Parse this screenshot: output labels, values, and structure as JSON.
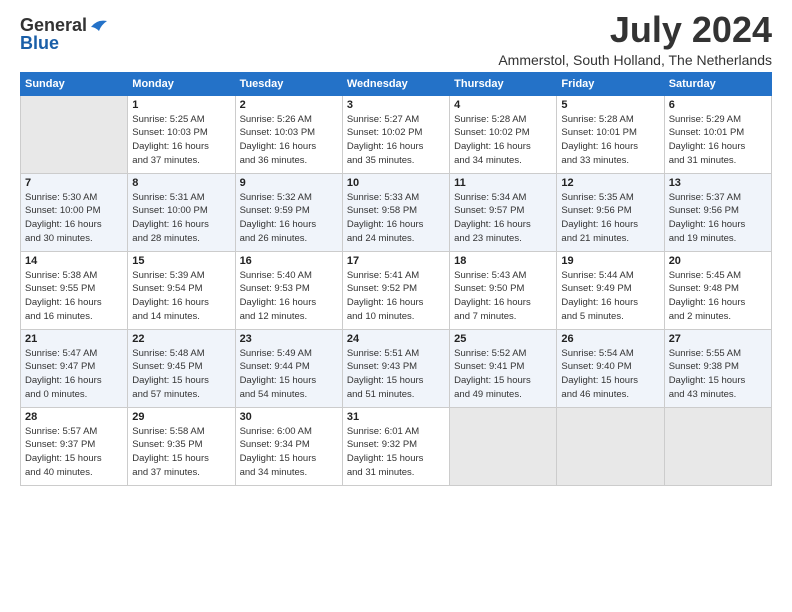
{
  "header": {
    "logo_general": "General",
    "logo_blue": "Blue",
    "month_title": "July 2024",
    "subtitle": "Ammerstol, South Holland, The Netherlands"
  },
  "columns": [
    "Sunday",
    "Monday",
    "Tuesday",
    "Wednesday",
    "Thursday",
    "Friday",
    "Saturday"
  ],
  "weeks": [
    [
      {
        "day": "",
        "info": ""
      },
      {
        "day": "1",
        "info": "Sunrise: 5:25 AM\nSunset: 10:03 PM\nDaylight: 16 hours\nand 37 minutes."
      },
      {
        "day": "2",
        "info": "Sunrise: 5:26 AM\nSunset: 10:03 PM\nDaylight: 16 hours\nand 36 minutes."
      },
      {
        "day": "3",
        "info": "Sunrise: 5:27 AM\nSunset: 10:02 PM\nDaylight: 16 hours\nand 35 minutes."
      },
      {
        "day": "4",
        "info": "Sunrise: 5:28 AM\nSunset: 10:02 PM\nDaylight: 16 hours\nand 34 minutes."
      },
      {
        "day": "5",
        "info": "Sunrise: 5:28 AM\nSunset: 10:01 PM\nDaylight: 16 hours\nand 33 minutes."
      },
      {
        "day": "6",
        "info": "Sunrise: 5:29 AM\nSunset: 10:01 PM\nDaylight: 16 hours\nand 31 minutes."
      }
    ],
    [
      {
        "day": "7",
        "info": "Sunrise: 5:30 AM\nSunset: 10:00 PM\nDaylight: 16 hours\nand 30 minutes."
      },
      {
        "day": "8",
        "info": "Sunrise: 5:31 AM\nSunset: 10:00 PM\nDaylight: 16 hours\nand 28 minutes."
      },
      {
        "day": "9",
        "info": "Sunrise: 5:32 AM\nSunset: 9:59 PM\nDaylight: 16 hours\nand 26 minutes."
      },
      {
        "day": "10",
        "info": "Sunrise: 5:33 AM\nSunset: 9:58 PM\nDaylight: 16 hours\nand 24 minutes."
      },
      {
        "day": "11",
        "info": "Sunrise: 5:34 AM\nSunset: 9:57 PM\nDaylight: 16 hours\nand 23 minutes."
      },
      {
        "day": "12",
        "info": "Sunrise: 5:35 AM\nSunset: 9:56 PM\nDaylight: 16 hours\nand 21 minutes."
      },
      {
        "day": "13",
        "info": "Sunrise: 5:37 AM\nSunset: 9:56 PM\nDaylight: 16 hours\nand 19 minutes."
      }
    ],
    [
      {
        "day": "14",
        "info": "Sunrise: 5:38 AM\nSunset: 9:55 PM\nDaylight: 16 hours\nand 16 minutes."
      },
      {
        "day": "15",
        "info": "Sunrise: 5:39 AM\nSunset: 9:54 PM\nDaylight: 16 hours\nand 14 minutes."
      },
      {
        "day": "16",
        "info": "Sunrise: 5:40 AM\nSunset: 9:53 PM\nDaylight: 16 hours\nand 12 minutes."
      },
      {
        "day": "17",
        "info": "Sunrise: 5:41 AM\nSunset: 9:52 PM\nDaylight: 16 hours\nand 10 minutes."
      },
      {
        "day": "18",
        "info": "Sunrise: 5:43 AM\nSunset: 9:50 PM\nDaylight: 16 hours\nand 7 minutes."
      },
      {
        "day": "19",
        "info": "Sunrise: 5:44 AM\nSunset: 9:49 PM\nDaylight: 16 hours\nand 5 minutes."
      },
      {
        "day": "20",
        "info": "Sunrise: 5:45 AM\nSunset: 9:48 PM\nDaylight: 16 hours\nand 2 minutes."
      }
    ],
    [
      {
        "day": "21",
        "info": "Sunrise: 5:47 AM\nSunset: 9:47 PM\nDaylight: 16 hours\nand 0 minutes."
      },
      {
        "day": "22",
        "info": "Sunrise: 5:48 AM\nSunset: 9:45 PM\nDaylight: 15 hours\nand 57 minutes."
      },
      {
        "day": "23",
        "info": "Sunrise: 5:49 AM\nSunset: 9:44 PM\nDaylight: 15 hours\nand 54 minutes."
      },
      {
        "day": "24",
        "info": "Sunrise: 5:51 AM\nSunset: 9:43 PM\nDaylight: 15 hours\nand 51 minutes."
      },
      {
        "day": "25",
        "info": "Sunrise: 5:52 AM\nSunset: 9:41 PM\nDaylight: 15 hours\nand 49 minutes."
      },
      {
        "day": "26",
        "info": "Sunrise: 5:54 AM\nSunset: 9:40 PM\nDaylight: 15 hours\nand 46 minutes."
      },
      {
        "day": "27",
        "info": "Sunrise: 5:55 AM\nSunset: 9:38 PM\nDaylight: 15 hours\nand 43 minutes."
      }
    ],
    [
      {
        "day": "28",
        "info": "Sunrise: 5:57 AM\nSunset: 9:37 PM\nDaylight: 15 hours\nand 40 minutes."
      },
      {
        "day": "29",
        "info": "Sunrise: 5:58 AM\nSunset: 9:35 PM\nDaylight: 15 hours\nand 37 minutes."
      },
      {
        "day": "30",
        "info": "Sunrise: 6:00 AM\nSunset: 9:34 PM\nDaylight: 15 hours\nand 34 minutes."
      },
      {
        "day": "31",
        "info": "Sunrise: 6:01 AM\nSunset: 9:32 PM\nDaylight: 15 hours\nand 31 minutes."
      },
      {
        "day": "",
        "info": ""
      },
      {
        "day": "",
        "info": ""
      },
      {
        "day": "",
        "info": ""
      }
    ]
  ]
}
